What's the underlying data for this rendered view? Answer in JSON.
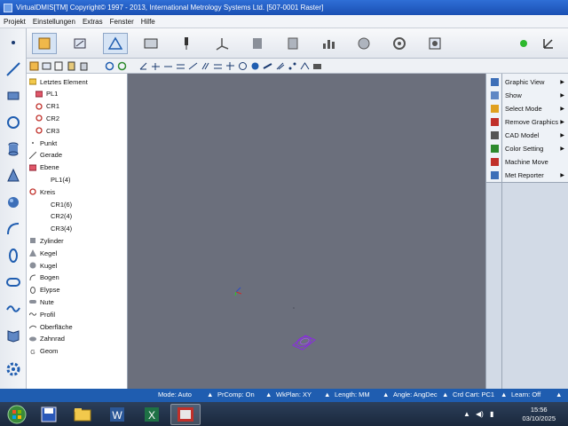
{
  "window": {
    "title": "VirtualDMIS[TM] Copyright© 1997 - 2013,  International Metrology Systems Ltd.  [507-0001 Raster]"
  },
  "menu": [
    "Projekt",
    "Einstellungen",
    "Extras",
    "Fenster",
    "Hilfe"
  ],
  "toolbar": {
    "icons": [
      "project-icon",
      "measure-icon",
      "workplane-icon",
      "machine-icon",
      "probe-icon",
      "coordinate-icon",
      "scanner-icon",
      "report-icon",
      "statistics-icon",
      "export-icon",
      "settings-icon",
      "camera-icon"
    ],
    "status_dot_color": "#2db82d"
  },
  "tree": {
    "items": [
      {
        "label": "Letztes Element",
        "icon": "folder-icon"
      },
      {
        "label": "PL1",
        "icon": "plane-icon"
      },
      {
        "label": "CR1",
        "icon": "circle-icon"
      },
      {
        "label": "CR2",
        "icon": "circle-icon"
      },
      {
        "label": "CR3",
        "icon": "circle-icon"
      },
      {
        "label": "Punkt",
        "icon": "point-icon"
      },
      {
        "label": "Gerade",
        "icon": "line-icon"
      },
      {
        "label": "Ebene",
        "icon": "plane-icon"
      },
      {
        "label": "PL1(4)",
        "icon": ""
      },
      {
        "label": "Kreis",
        "icon": "circle-icon"
      },
      {
        "label": "CR1(6)",
        "icon": ""
      },
      {
        "label": "CR2(4)",
        "icon": ""
      },
      {
        "label": "CR3(4)",
        "icon": ""
      },
      {
        "label": "Zylinder",
        "icon": "cylinder-icon"
      },
      {
        "label": "Kegel",
        "icon": "cone-icon"
      },
      {
        "label": "Kugel",
        "icon": "sphere-icon"
      },
      {
        "label": "Bogen",
        "icon": "arc-icon"
      },
      {
        "label": "Elypse",
        "icon": "ellipse-icon"
      },
      {
        "label": "Nute",
        "icon": "slot-icon"
      },
      {
        "label": "Profil",
        "icon": "profile-icon"
      },
      {
        "label": "Oberfläche",
        "icon": "surface-icon"
      },
      {
        "label": "Zahnrad",
        "icon": "gear-wheel-icon"
      },
      {
        "label": "Geom",
        "icon": "geom-icon"
      }
    ]
  },
  "context_menu": [
    {
      "label": "Graphic View",
      "submenu": true
    },
    {
      "label": "Show",
      "submenu": true
    },
    {
      "label": "Select Mode",
      "submenu": true
    },
    {
      "label": "Remove Graphics",
      "submenu": true
    },
    {
      "label": "CAD Model",
      "submenu": true
    },
    {
      "label": "Color Setting",
      "submenu": true
    },
    {
      "label": "Machine Move",
      "submenu": false
    },
    {
      "label": "Met Reporter",
      "submenu": true
    }
  ],
  "status": {
    "mode": "Mode: Auto",
    "prcomp": "PrComp: On",
    "wkplan": "WkPlan: XY",
    "length": "Length: MM",
    "angle": "Angle: AngDec",
    "crd": "Crd Cart: PC1",
    "learn": "Learn: Off"
  },
  "taskbar": {
    "time": "15:56",
    "date": "03/10/2025",
    "apps": [
      "start-orb-icon",
      "save-icon",
      "folder-icon",
      "word-icon",
      "excel-icon",
      "virtualdmis-icon"
    ]
  },
  "colors": {
    "viewport_bg": "#6b6f7c",
    "feature_color": "#8a2be2"
  }
}
